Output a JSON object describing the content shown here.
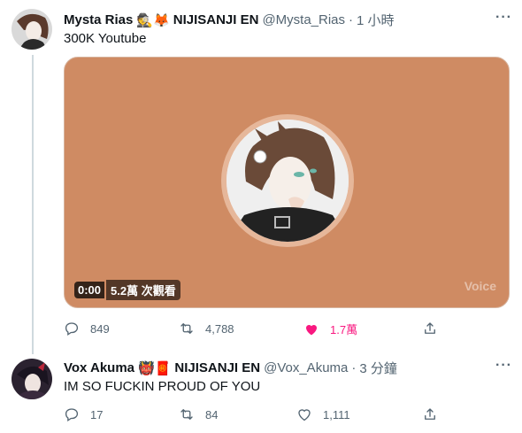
{
  "tweets": [
    {
      "name": "Mysta Rias",
      "emoji": "🕵🦊",
      "affiliation": "NIJISANJI EN",
      "handle": "@Mysta_Rias",
      "time": "1 小時",
      "text": "300K Youtube",
      "media": {
        "current_time": "0:00",
        "views": "5.2萬 次觀看",
        "brand": "Voice",
        "background": "#cf8b63"
      },
      "actions": {
        "replies": "849",
        "retweets": "4,788",
        "likes": "1.7萬",
        "liked": true
      }
    },
    {
      "name": "Vox Akuma",
      "emoji": "👹🧧",
      "affiliation": "NIJISANJI EN",
      "handle": "@Vox_Akuma",
      "time": "3 分鐘",
      "text": "IM SO FUCKIN PROUD OF YOU",
      "actions": {
        "replies": "17",
        "retweets": "84",
        "likes": "1,111",
        "liked": false
      }
    }
  ],
  "icons": {
    "reply": "reply-icon",
    "retweet": "retweet-icon",
    "like": "heart-icon",
    "share": "share-icon",
    "more": "more-icon"
  },
  "colors": {
    "like_active": "#f91880",
    "secondary_text": "#536471",
    "media_bg": "#cf8b63"
  }
}
